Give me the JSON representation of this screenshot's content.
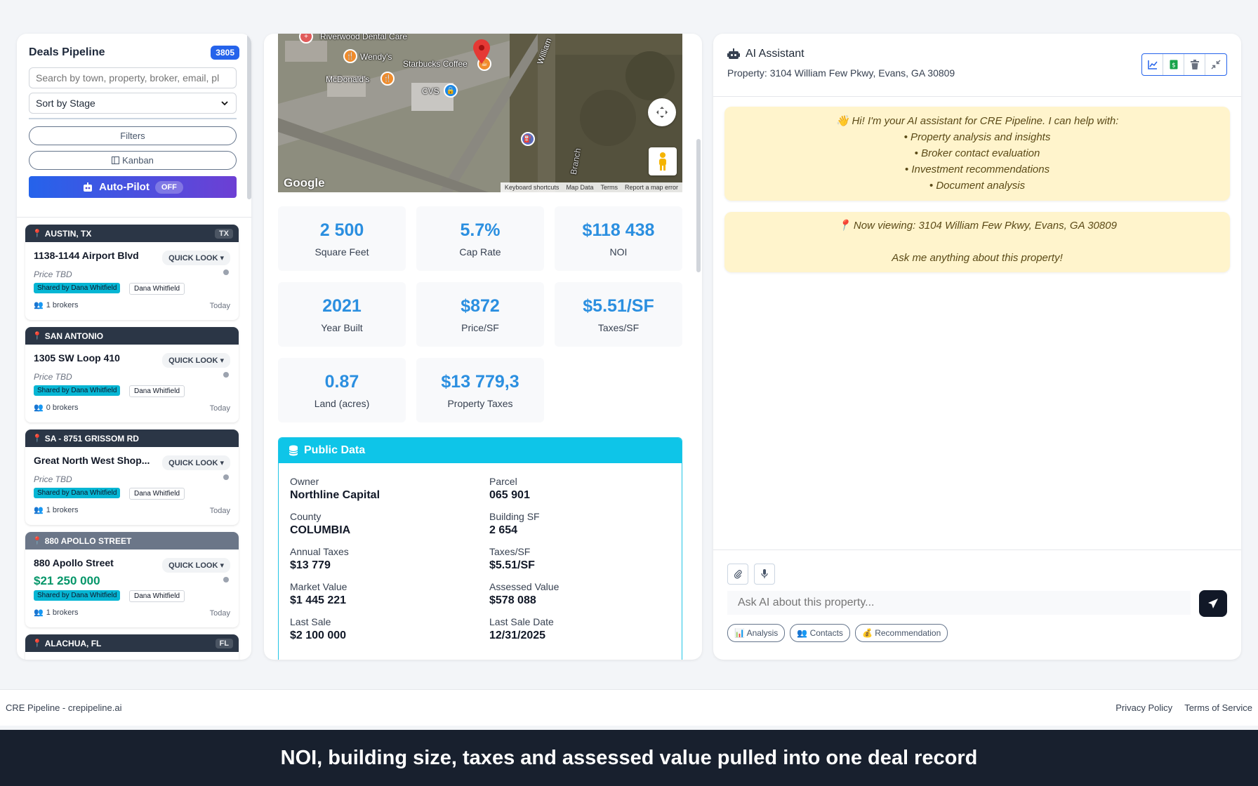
{
  "colors": {
    "accent": "#2563eb",
    "stat_value": "#2b8fe0",
    "public_header": "#0ec5e8",
    "ai_bubble": "#fff4cc",
    "deal_header": "#2b3646",
    "price_green": "#059669"
  },
  "pipeline": {
    "title": "Deals Pipeline",
    "count": "3805",
    "search_placeholder": "Search by town, property, broker, email, pl",
    "sort_label": "Sort by Stage",
    "filters_label": "Filters",
    "kanban_label": "Kanban",
    "autopilot_label": "Auto-Pilot",
    "autopilot_state": "OFF",
    "deals": [
      {
        "location": "AUSTIN, TX",
        "state": "TX",
        "name": "1138-1144 Airport Blvd",
        "quick_look": "QUICK LOOK",
        "price": "Price TBD",
        "shared": "Shared by Dana Whitfield",
        "owner": "Dana Whitfield",
        "brokers": "1 brokers",
        "date": "Today"
      },
      {
        "location": "SAN ANTONIO",
        "state": "",
        "name": "1305 SW Loop 410",
        "quick_look": "QUICK LOOK",
        "price": "Price TBD",
        "shared": "Shared by Dana Whitfield",
        "owner": "Dana Whitfield",
        "brokers": "0 brokers",
        "date": "Today"
      },
      {
        "location": "SA - 8751 GRISSOM RD",
        "state": "",
        "name": "Great North West Shop...",
        "quick_look": "QUICK LOOK",
        "price": "Price TBD",
        "shared": "Shared by Dana Whitfield",
        "owner": "Dana Whitfield",
        "brokers": "1 brokers",
        "date": "Today"
      },
      {
        "location": "880 APOLLO STREET",
        "state": "",
        "name": "880 Apollo Street",
        "quick_look": "QUICK LOOK",
        "price": "$21 250 000",
        "shared": "Shared by Dana Whitfield",
        "owner": "Dana Whitfield",
        "brokers": "1 brokers",
        "date": "Today"
      },
      {
        "location": "ALACHUA, FL",
        "state": "FL"
      }
    ]
  },
  "map": {
    "labels": {
      "dental": "Riverwood Dental Care",
      "wendys": "Wendy's",
      "starbucks": "Starbucks Coffee",
      "mcdonalds": "McDonald's",
      "cvs": "CVS",
      "road": "William",
      "branch": "Branch"
    },
    "google": "Google",
    "footer": [
      "Keyboard shortcuts",
      "Map Data",
      "Terms",
      "Report a map error"
    ]
  },
  "stats": [
    {
      "value": "2 500",
      "label": "Square Feet"
    },
    {
      "value": "5.7%",
      "label": "Cap Rate"
    },
    {
      "value": "$118 438",
      "label": "NOI"
    },
    {
      "value": "2021",
      "label": "Year Built"
    },
    {
      "value": "$872",
      "label": "Price/SF"
    },
    {
      "value": "$5.51/SF",
      "label": "Taxes/SF"
    },
    {
      "value": "0.87",
      "label": "Land (acres)"
    },
    {
      "value": "$13 779,3",
      "label": "Property Taxes"
    }
  ],
  "public_data": {
    "title": "Public Data",
    "fields": [
      {
        "label": "Owner",
        "value": "Northline Capital"
      },
      {
        "label": "Parcel",
        "value": "065 901"
      },
      {
        "label": "County",
        "value": "COLUMBIA"
      },
      {
        "label": "Building SF",
        "value": "2 654"
      },
      {
        "label": "Annual Taxes",
        "value": "$13 779"
      },
      {
        "label": "Taxes/SF",
        "value": "$5.51/SF"
      },
      {
        "label": "Market Value",
        "value": "$1 445 221"
      },
      {
        "label": "Assessed Value",
        "value": "$578 088"
      },
      {
        "label": "Last Sale",
        "value": "$2 100 000"
      },
      {
        "label": "Last Sale Date",
        "value": "12/31/2025"
      }
    ]
  },
  "assistant": {
    "title": "AI Assistant",
    "property": "Property: 3104 William Few Pkwy, Evans, GA 30809",
    "tools": [
      "chart-icon",
      "spreadsheet-icon",
      "trash-icon",
      "collapse-icon"
    ],
    "greeting": {
      "intro": "👋 Hi! I'm your AI assistant for CRE Pipeline. I can help with:",
      "items": [
        "• Property analysis and insights",
        "• Broker contact evaluation",
        "• Investment recommendations",
        "• Document analysis"
      ]
    },
    "viewing": {
      "line1": "📍 Now viewing: 3104 William Few Pkwy, Evans, GA 30809",
      "line2": "Ask me anything about this property!"
    },
    "input_placeholder": "Ask AI about this property...",
    "chips": [
      "📊 Analysis",
      "👥 Contacts",
      "💰 Recommendation"
    ]
  },
  "footer": {
    "brand": "CRE Pipeline - crepipeline.ai",
    "privacy": "Privacy Policy",
    "terms": "Terms of Service"
  },
  "caption": "NOI, building size, taxes and assessed value pulled into one deal record"
}
